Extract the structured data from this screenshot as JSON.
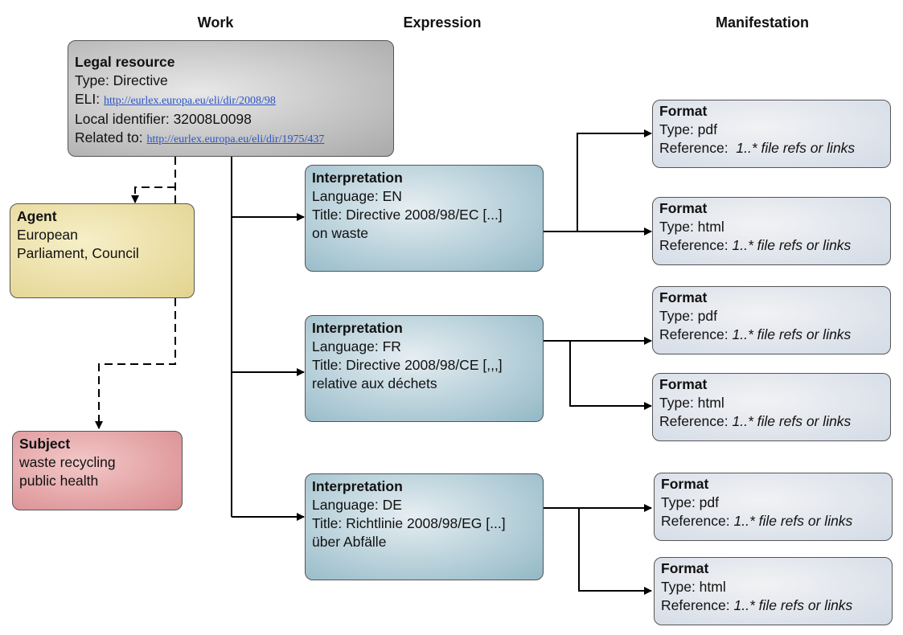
{
  "headers": {
    "work": "Work",
    "expression": "Expression",
    "manifestation": "Manifestation"
  },
  "legal_resource": {
    "title": "Legal resource",
    "type": "Type: Directive",
    "eli_label": "ELI:",
    "eli_link": "http://eurlex.europa.eu/eli/dir/2008/98",
    "local_id": "Local identifier: 32008L0098",
    "related_label": "Related to:",
    "related_link": "http://eurlex.europa.eu/eli/dir/1975/437"
  },
  "agent": {
    "title": "Agent",
    "line1": "European",
    "line2": "Parliament, Council"
  },
  "subject": {
    "title": "Subject",
    "line1": "waste recycling",
    "line2": "public health"
  },
  "interpretations": [
    {
      "title": "Interpretation",
      "language": "Language: EN",
      "title_line": "Title: Directive 2008/98/EC [...]",
      "title_line2": "on waste"
    },
    {
      "title": "Interpretation",
      "language": "Language: FR",
      "title_line": "Title: Directive 2008/98/CE [,,,]",
      "title_line2": "relative aux déchets"
    },
    {
      "title": "Interpretation",
      "language": "Language: DE",
      "title_line": "Title: Richtlinie 2008/98/EG [...]",
      "title_line2": "über Abfälle"
    }
  ],
  "formats": [
    {
      "title": "Format",
      "type": "Type: pdf",
      "ref_label": "Reference:",
      "ref_value": "1..* file refs or links"
    },
    {
      "title": "Format",
      "type": "Type: html",
      "ref_label": "Reference:",
      "ref_value": "1..* file refs or links"
    },
    {
      "title": "Format",
      "type": "Type: pdf",
      "ref_label": "Reference:",
      "ref_value": "1..* file refs or links"
    },
    {
      "title": "Format",
      "type": "Type: html",
      "ref_label": "Reference:",
      "ref_value": "1..* file refs or links"
    },
    {
      "title": "Format",
      "type": "Type: pdf",
      "ref_label": "Reference:",
      "ref_value": "1..* file refs or links"
    },
    {
      "title": "Format",
      "type": "Type: html",
      "ref_label": "Reference:",
      "ref_value": "1..* file refs or links"
    }
  ]
}
